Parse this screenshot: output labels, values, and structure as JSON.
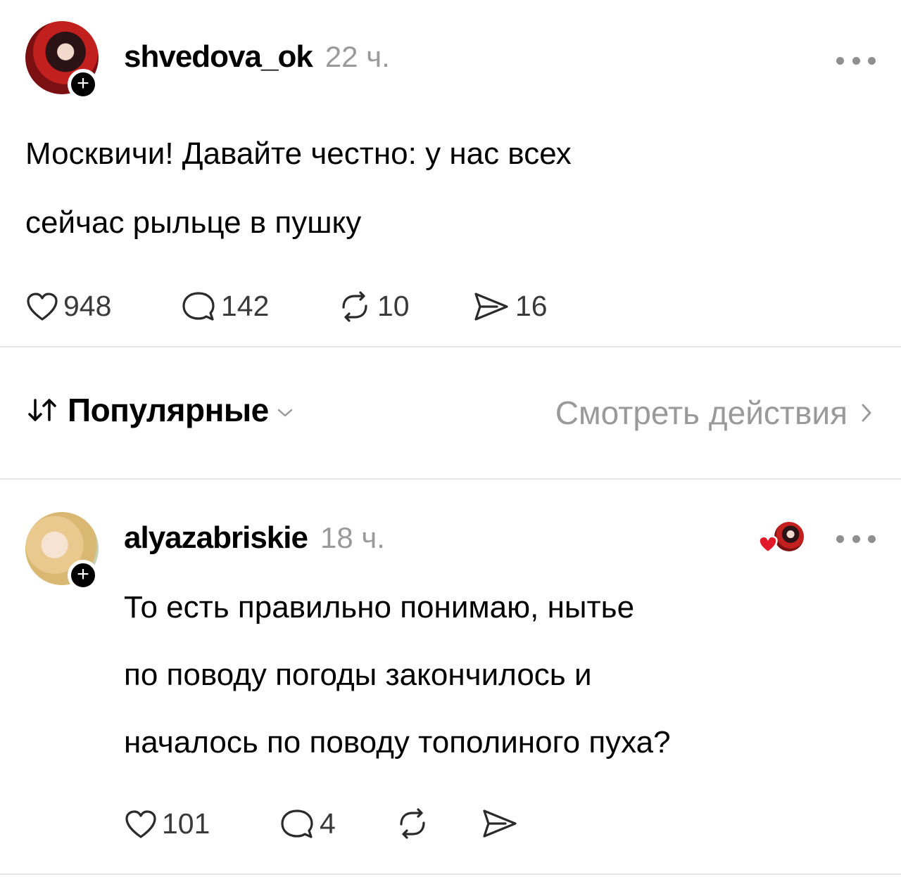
{
  "post": {
    "username": "shvedova_ok",
    "time": "22 ч.",
    "text_lines": [
      "Москвичи! Давайте честно: у нас всех",
      "сейчас рыльце в пушку"
    ],
    "likes": "948",
    "comments": "142",
    "reposts": "10",
    "shares": "16"
  },
  "sort": {
    "label": "Популярные",
    "view_activity": "Смотреть действия"
  },
  "reply": {
    "username": "alyazabriskie",
    "time": "18 ч.",
    "text_lines": [
      "То есть правильно понимаю, нытье",
      "по поводу погоды закончилось и",
      "началось по поводу тополиного пуха?"
    ],
    "likes": "101",
    "comments": "4"
  },
  "icons": {
    "like": "heart-icon",
    "comment": "comment-icon",
    "repost": "repost-icon",
    "share": "share-icon",
    "more": "more-icon",
    "sort": "sort-arrows-icon",
    "chevron_down": "chevron-down-icon",
    "chevron_right": "chevron-right-icon",
    "follow": "plus-icon"
  },
  "colors": {
    "liked_heart": "#e0192b",
    "muted": "#9a9a9a"
  }
}
